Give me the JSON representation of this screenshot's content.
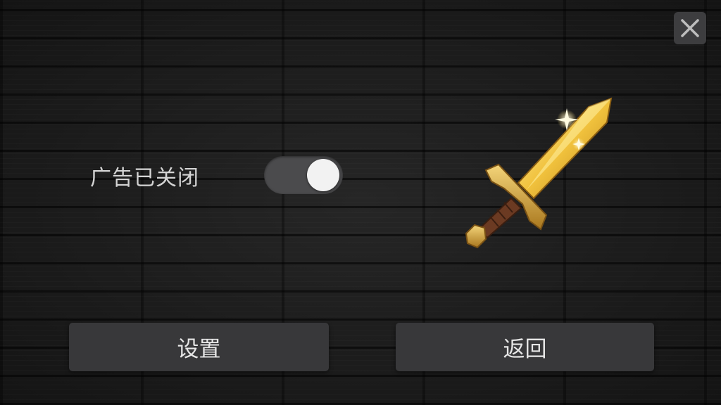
{
  "ad_setting": {
    "label": "广告已关闭",
    "toggle_on": true
  },
  "buttons": {
    "settings": "设置",
    "back": "返回"
  },
  "icons": {
    "close": "close-icon",
    "sword": "sword-icon"
  },
  "colors": {
    "button_bg": "#38383a",
    "toggle_track": "#4b4b4d",
    "toggle_knob": "#f2f2f2",
    "text": "#d4d4d4"
  }
}
